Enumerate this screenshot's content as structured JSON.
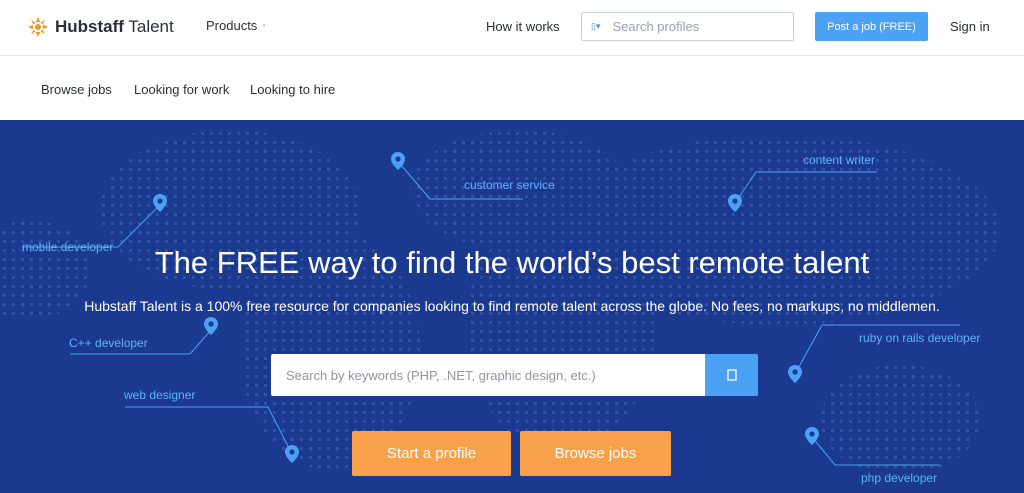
{
  "brand": {
    "name_bold": "Hubstaff",
    "name_rest": " Talent"
  },
  "nav": {
    "products": "Products",
    "how_it_works": "How it works",
    "search_placeholder": "Search profiles",
    "post_job": "Post a job (FREE)",
    "sign_in": "Sign in"
  },
  "subnav": [
    "Browse jobs",
    "Looking for work",
    "Looking to hire"
  ],
  "hero": {
    "title": "The FREE way to find the world’s best remote talent",
    "subtitle": "Hubstaff Talent is a 100% free resource for companies looking to find remote talent across the globe. No fees, no markups, no middlemen.",
    "search_placeholder": "Search by keywords (PHP, .NET, graphic design, etc.)",
    "start_profile": "Start a profile",
    "browse_jobs": "Browse jobs"
  },
  "tags": [
    "customer service",
    "content writer",
    "mobile developer",
    "C++ developer",
    "ruby on rails developer",
    "web designer",
    "php developer"
  ],
  "colors": {
    "hero_bg": "#1b3a8f",
    "accent_blue": "#4ba1f3",
    "accent_orange": "#f9a04a",
    "tag_blue": "#5fb2ff"
  }
}
